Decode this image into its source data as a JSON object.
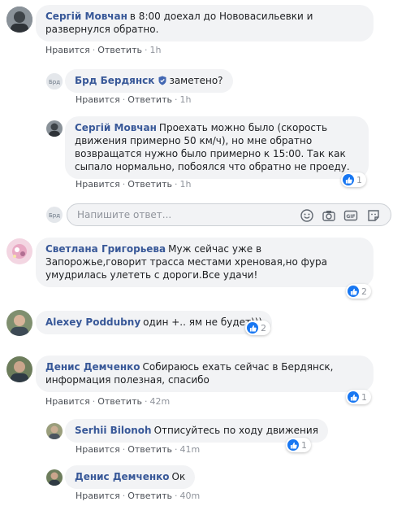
{
  "actions": {
    "like": "Нравится",
    "reply": "Ответить",
    "sep": "·"
  },
  "comments": [
    {
      "author": "Сергій Мовчан",
      "text": "в 8:00 доехал до Нововасильевки и развернулся обратно.",
      "time": "1h"
    },
    {
      "author": "Брд Бердянск",
      "text": "заметено?",
      "time": "1h",
      "verified": true
    },
    {
      "author": "Сергій Мовчан",
      "text": "Проехать можно было (скорость движения примерно 50 км/ч), но мне обратно возвращатся нужно было примерно к 15:00. Так как сыпало нормально, побоялся что обратно не проеду.",
      "time": "1h",
      "likes": "1"
    },
    {
      "author": "Светлана Григорьева",
      "text": "Муж сейчас уже в Запорожье,говорит трасса местами хреновая,но фура умудрилась улететь с дороги.Все удачи!",
      "likes": "2"
    },
    {
      "author": "Alexey Poddubny",
      "text": "один +.. ям не будет)))",
      "likes": "2"
    },
    {
      "author": "Денис Демченко",
      "text": "Собираюсь ехать сейчас в Бердянск, информация полезная, спасибо",
      "time": "42m",
      "likes": "1"
    },
    {
      "author": "Serhii Bilonoh",
      "text": "Отписуйтесь по ходу движения",
      "time": "41m",
      "likes": "1"
    },
    {
      "author": "Денис Демченко",
      "text": "Ок",
      "time": "40m"
    }
  ],
  "reply_box": {
    "placeholder": "Напишите ответ..."
  },
  "icons": {
    "reply_tools": [
      "emoji-icon",
      "camera-icon",
      "gif-icon",
      "sticker-icon"
    ],
    "reaction": "like-icon",
    "verified": "verified-badge-icon"
  },
  "colors": {
    "author": "#385898",
    "bubble": "#f2f3f5",
    "like": "#1877f2",
    "meta": "#90949c"
  }
}
